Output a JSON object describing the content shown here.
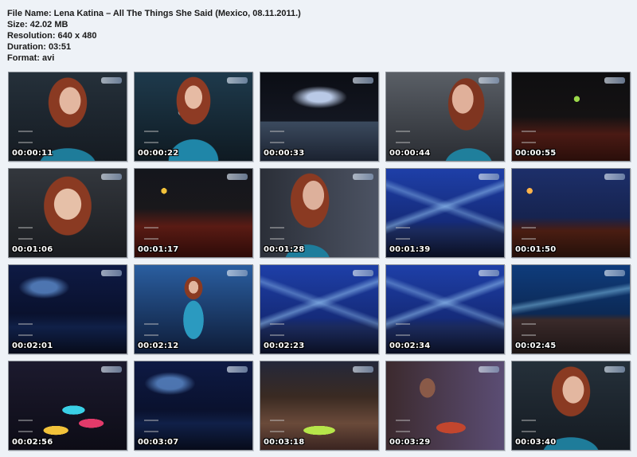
{
  "info": {
    "file_name": "File Name: Lena Katina – All The Things She Said (Mexico, 08.11.2011.)",
    "size": "Size: 42.02 MB",
    "resolution": "Resolution: 640 x 480",
    "duration": "Duration: 03:51",
    "format": "Format:  avi"
  },
  "thumbnails": [
    {
      "time": "00:00:11",
      "scene": "singer-closeup"
    },
    {
      "time": "00:00:22",
      "scene": "singer-front"
    },
    {
      "time": "00:00:33",
      "scene": "stage-wide-lights"
    },
    {
      "time": "00:00:44",
      "scene": "singer-profile"
    },
    {
      "time": "00:00:55",
      "scene": "stage-dark-screen"
    },
    {
      "time": "00:01:06",
      "scene": "singer-closeup-mic"
    },
    {
      "time": "00:01:17",
      "scene": "stage-dark-red"
    },
    {
      "time": "00:01:28",
      "scene": "singer-side"
    },
    {
      "time": "00:01:39",
      "scene": "stage-blue-beams"
    },
    {
      "time": "00:01:50",
      "scene": "stage-blue-crowd"
    },
    {
      "time": "00:02:01",
      "scene": "stage-blue-dark"
    },
    {
      "time": "00:02:12",
      "scene": "singer-full-body"
    },
    {
      "time": "00:02:23",
      "scene": "stage-blue-beams"
    },
    {
      "time": "00:02:34",
      "scene": "stage-blue-beams"
    },
    {
      "time": "00:02:45",
      "scene": "crowd-blue"
    },
    {
      "time": "00:02:56",
      "scene": "drums-colorful"
    },
    {
      "time": "00:03:07",
      "scene": "stage-blue-dark"
    },
    {
      "time": "00:03:18",
      "scene": "crowd-wide"
    },
    {
      "time": "00:03:29",
      "scene": "drummer"
    },
    {
      "time": "00:03:40",
      "scene": "singer-closeup"
    }
  ]
}
